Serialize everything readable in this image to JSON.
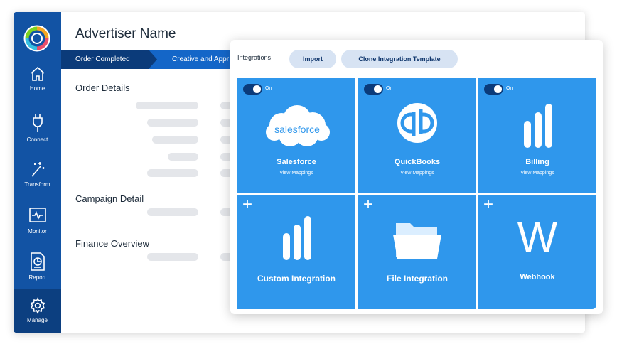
{
  "sidebar": {
    "items": [
      {
        "label": "Home",
        "icon": "home-icon"
      },
      {
        "label": "Connect",
        "icon": "plug-icon"
      },
      {
        "label": "Transform",
        "icon": "magic-wand-icon"
      },
      {
        "label": "Monitor",
        "icon": "monitor-icon"
      },
      {
        "label": "Report",
        "icon": "report-icon"
      },
      {
        "label": "Manage",
        "icon": "gear-icon",
        "active": true
      }
    ]
  },
  "main": {
    "title": "Advertiser Name",
    "steps": [
      "Order Completed",
      "Creative and Appr"
    ],
    "sections": [
      "Order Details",
      "Campaign Detail",
      "Finance Overview"
    ]
  },
  "integrations": {
    "label": "Integrations",
    "buttons": {
      "import": "Import",
      "clone": "Clone Integration Template"
    },
    "tiles": [
      {
        "name": "Salesforce",
        "logo_text": "salesforce",
        "link": "View Mappings",
        "toggle": "On",
        "enabled": true
      },
      {
        "name": "QuickBooks",
        "link": "View Mappings",
        "toggle": "On",
        "enabled": true
      },
      {
        "name": "Billing",
        "link": "View Mappings",
        "toggle": "On",
        "enabled": true
      },
      {
        "name": "Custom Integration",
        "icon": "bar-chart-icon"
      },
      {
        "name": "File Integration",
        "icon": "folder-icon"
      },
      {
        "name": "Webhook",
        "logo_text": "W"
      }
    ]
  },
  "colors": {
    "sidebar": "#1253a4",
    "tile": "#2f97ec",
    "step_active": "#0b3b7a",
    "step": "#1466c8",
    "pill": "#d7e3f3"
  }
}
